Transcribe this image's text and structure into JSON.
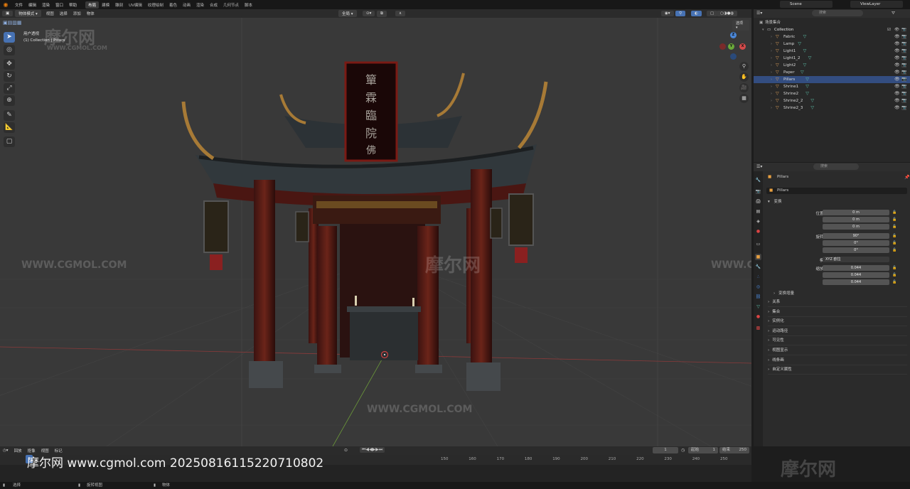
{
  "topbar": {
    "menus": [
      "文件",
      "编辑",
      "渲染",
      "窗口",
      "帮助"
    ],
    "workspaces": [
      "布局",
      "建模",
      "雕刻",
      "UV编辑",
      "纹理绘制",
      "着色",
      "动画",
      "渲染",
      "合成",
      "几何节点",
      "脚本"
    ],
    "active_workspace": "布局",
    "scene": "Scene",
    "view_layer": "ViewLayer"
  },
  "viewport": {
    "mode": "物体模式",
    "menus": [
      "视图",
      "选择",
      "添加",
      "物体"
    ],
    "transform_orientation": "全局",
    "view_name": "用户透视",
    "context_line": "(1) Collection | Pillars",
    "options_label": "选项",
    "gizmo_axes": [
      "X",
      "Y",
      "Z"
    ],
    "accent": "#4772b3"
  },
  "outliner": {
    "root": "场景集合",
    "collection": "Collection",
    "items": [
      "Fabric",
      "Lamp",
      "Light1",
      "Light1_2",
      "Light2",
      "Paper",
      "Pillars",
      "Shrine1",
      "Shrine2",
      "Shrine2_2",
      "Shrine2_3"
    ],
    "selected": "Pillars",
    "search_placeholder": "搜索"
  },
  "properties": {
    "search_placeholder": "搜索",
    "object_name": "Pillars",
    "object_datablock": "Pillars",
    "transform_section": "变换",
    "location_label": "位置 X",
    "rotation_label": "旋转 X",
    "scale_label": "缩放 X",
    "axis_y": "Y",
    "axis_z": "Z",
    "location": [
      "0 m",
      "0 m",
      "0 m"
    ],
    "rotation": [
      "90°",
      "0°",
      "0°"
    ],
    "mode_label": "模式",
    "mode_value": "XYZ 欧拉",
    "scale": [
      "0.044",
      "0.044",
      "0.044"
    ],
    "delta_section": "变换增量",
    "sections": [
      "关系",
      "集合",
      "实例化",
      "运动路径",
      "可见性",
      "视图显示",
      "线条画",
      "自定义属性"
    ]
  },
  "timeline": {
    "menus": [
      "回放",
      "抠像",
      "视图",
      "标记"
    ],
    "current_frame": "1",
    "start_label": "起始",
    "start_value": "1",
    "end_label": "结束",
    "end_value": "250",
    "ticks": [
      "150",
      "160",
      "170",
      "180",
      "190",
      "200",
      "210",
      "220",
      "230",
      "240",
      "250"
    ],
    "watermark_text": "摩尔网 www.cgmol.com 20250816115220710802"
  },
  "statusbar": {
    "left": "选择",
    "middle": "旋转视图",
    "right": "物体"
  },
  "watermarks": {
    "brand": "摩尔网",
    "site": "WWW.CGMOL.COM"
  }
}
